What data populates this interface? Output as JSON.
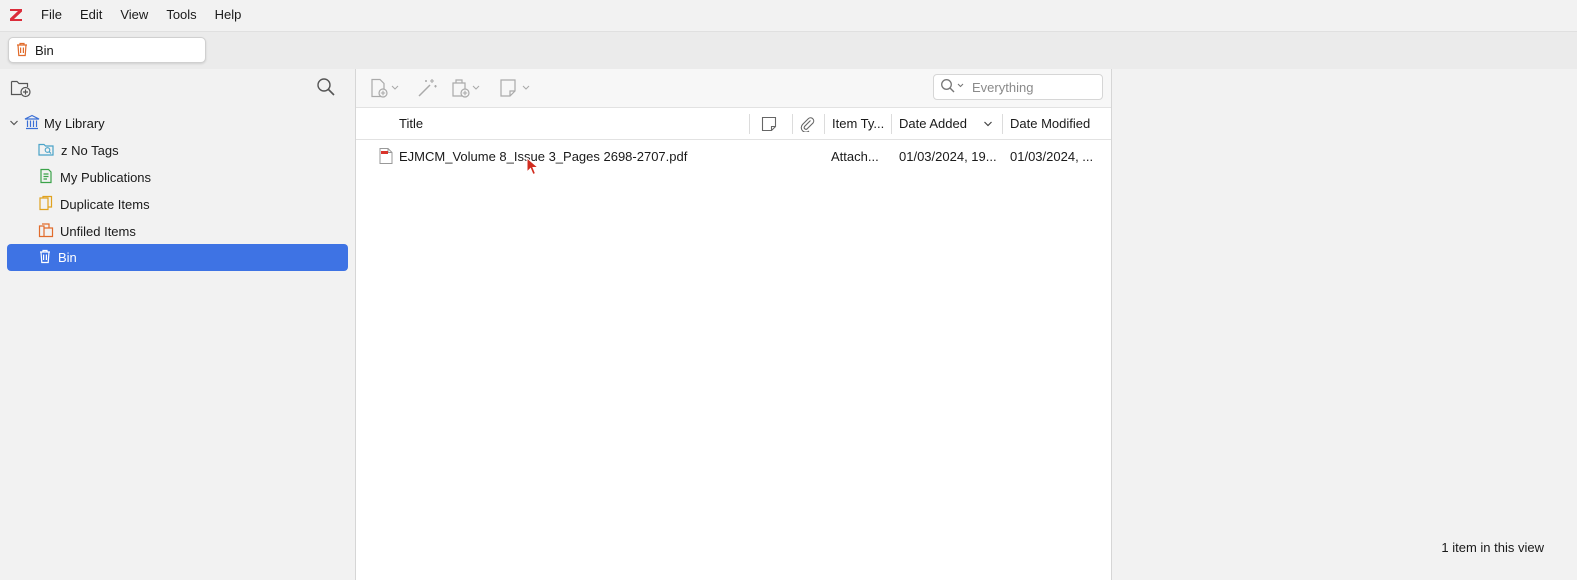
{
  "menu": {
    "logo": "Z",
    "items": [
      "File",
      "Edit",
      "View",
      "Tools",
      "Help"
    ]
  },
  "tab": {
    "label": "Bin",
    "icon": "trash-icon"
  },
  "collections": {
    "library": "My Library",
    "items": [
      {
        "label": "z No Tags",
        "icon": "saved-search-icon"
      },
      {
        "label": "My Publications",
        "icon": "publications-icon"
      },
      {
        "label": "Duplicate Items",
        "icon": "duplicate-icon"
      },
      {
        "label": "Unfiled Items",
        "icon": "unfiled-icon"
      },
      {
        "label": "Bin",
        "icon": "trash-icon",
        "selected": true
      }
    ]
  },
  "search": {
    "placeholder": "Everything"
  },
  "columns": {
    "title": "Title",
    "item_type": "Item Ty...",
    "date_added": "Date Added",
    "date_modified": "Date Modified"
  },
  "items": [
    {
      "title": "EJMCM_Volume 8_Issue 3_Pages 2698-2707.pdf",
      "item_type": "Attach...",
      "date_added": "01/03/2024, 19...",
      "date_modified": "01/03/2024, ..."
    }
  ],
  "status": "1 item in this view",
  "colors": {
    "accent": "#3e73e4",
    "logo": "#db2c3a",
    "trash": "#e16b2b",
    "library": "#3a6fd6"
  }
}
